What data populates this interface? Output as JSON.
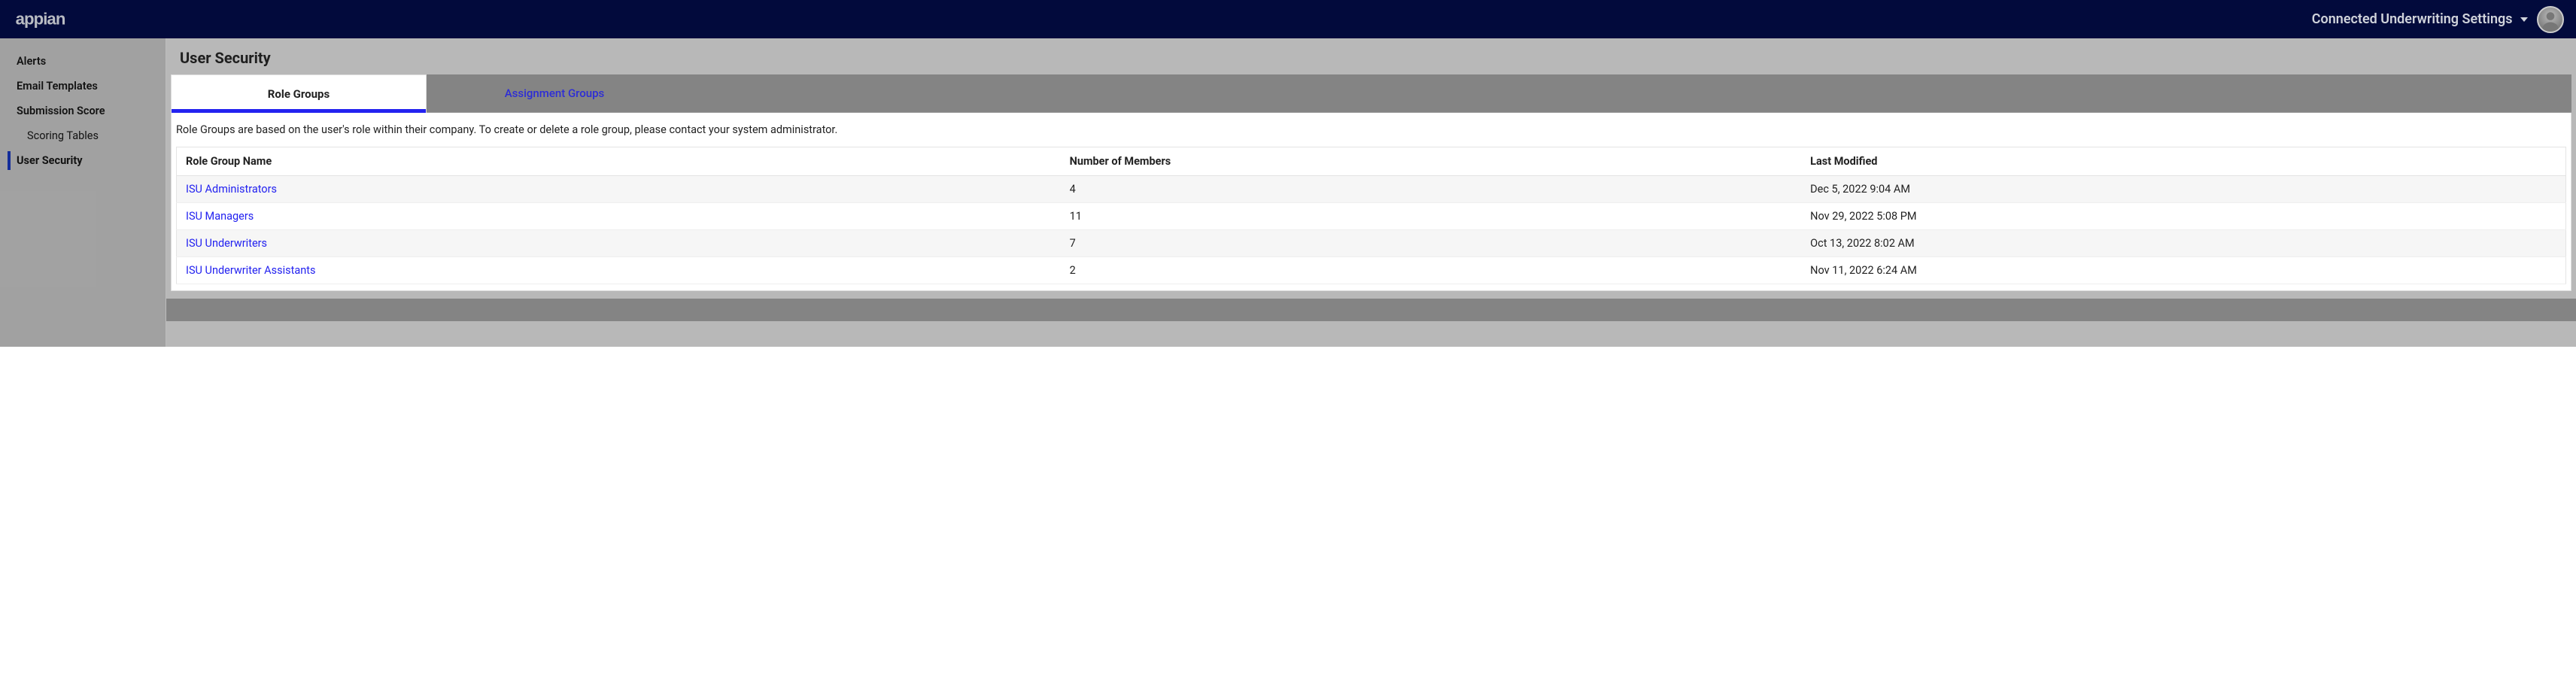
{
  "header": {
    "brand": "appian",
    "settings_label": "Connected Underwriting Settings"
  },
  "sidebar": {
    "items": [
      {
        "label": "Alerts",
        "key": "alerts"
      },
      {
        "label": "Email Templates",
        "key": "email-templates"
      },
      {
        "label": "Submission Score",
        "key": "submission-score"
      },
      {
        "label": "Scoring Tables",
        "key": "scoring-tables",
        "sub": true
      },
      {
        "label": "User Security",
        "key": "user-security",
        "active": true
      }
    ]
  },
  "page": {
    "title": "User Security"
  },
  "tabs": {
    "role_groups": "Role Groups",
    "assignment_groups": "Assignment Groups",
    "description": "Role Groups are based on the user's role within their company. To create or delete a role group, please contact your system administrator."
  },
  "table": {
    "columns": {
      "name": "Role Group Name",
      "members": "Number of Members",
      "modified": "Last Modified"
    },
    "rows": [
      {
        "name": "ISU Administrators",
        "members": "4",
        "modified": "Dec 5, 2022 9:04 AM"
      },
      {
        "name": "ISU Managers",
        "members": "11",
        "modified": "Nov 29, 2022 5:08 PM"
      },
      {
        "name": "ISU Underwriters",
        "members": "7",
        "modified": "Oct 13, 2022 8:02 AM"
      },
      {
        "name": "ISU Underwriter Assistants",
        "members": "2",
        "modified": "Nov 11, 2022 6:24 AM"
      }
    ]
  }
}
